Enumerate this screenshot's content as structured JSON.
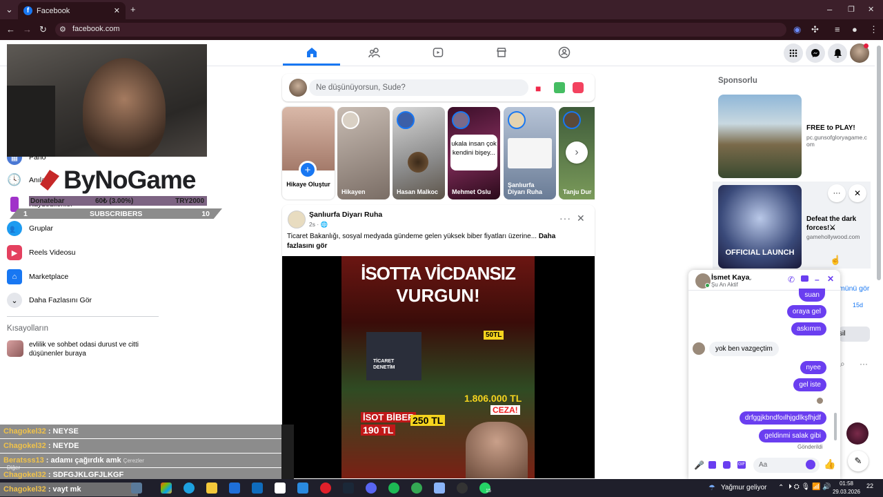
{
  "browser": {
    "tab_title": "Facebook",
    "new_tab": "+",
    "url": "facebook.com",
    "window_controls": [
      "–",
      "❐",
      "✕"
    ]
  },
  "facebook": {
    "nav_icons": [
      "home-icon",
      "friends-icon",
      "video-icon",
      "marketplace-icon",
      "groups-icon"
    ],
    "composer_placeholder": "Ne düşünüyorsun, Sude?",
    "left_items": [
      {
        "label": "Pano"
      },
      {
        "label": "Anılar"
      },
      {
        "label": "Kaydedilenler"
      },
      {
        "label": "Gruplar"
      },
      {
        "label": "Reels Videosu"
      },
      {
        "label": "Marketplace"
      },
      {
        "label": "Daha Fazlasını Gör"
      }
    ],
    "shortcuts_title": "Kısayolların",
    "shortcut_item": "evlilik ve sohbet odasi durust ve citti düşünenler buraya",
    "stories": [
      {
        "name": "Hikaye Oluştur"
      },
      {
        "name": "Hikayen"
      },
      {
        "name": "Hasan Malkoc"
      },
      {
        "name": "Mehmet Oslu"
      },
      {
        "name": "Şanlıurfa Diyarı Ruha"
      },
      {
        "name": "Tanju Durgu"
      }
    ],
    "story_bubble": "ukala insan çok kendini bişey...",
    "post": {
      "author": "Şanlıurfa Diyarı Ruha",
      "time": "2s · 🌐",
      "text": "Ticaret Bakanlığı, sosyal medyada gündeme gelen yüksek biber fiyatları üzerine...",
      "more": "Daha fazlasını gör",
      "poster_title_1": "İSOTTA VİCDANSIZ",
      "poster_title_2": "VURGUN!",
      "poster_label_1": "50TL",
      "poster_label_2": "1.806.000 TL",
      "poster_label_3": "CEZA!",
      "poster_label_4": "İSOT BİBER",
      "poster_label_5": "190 TL",
      "poster_label_6": "250 TL",
      "poster_label_7": "TİCARET DENETİM"
    },
    "sponsored_title": "Sponsorlu",
    "ads": [
      {
        "title": "FREE to PLAY!",
        "url": "pc.gunsofgloryagame.com"
      },
      {
        "title": "Defeat the dark forces!⚔",
        "url": "gamehollywood.com"
      }
    ],
    "ad_image_text": "OFFICIAL LAUNCH",
    "partial_texts": [
      "münü gör",
      "15d",
      "sil"
    ]
  },
  "chat": {
    "name": "İsmet Kaya",
    "status": "Şu An Aktif",
    "messages_out_1": [
      "suan",
      "oraya gel",
      "askımm"
    ],
    "message_in": "yok ben vazgeçtim",
    "messages_out_2": [
      "nyee",
      "gel iste"
    ],
    "messages_out_3": [
      "drfggjkbndfoılhjgdlkşfhjdf",
      "geldinmi salak gibi"
    ],
    "sent_status": "Gönderildi",
    "input_placeholder": "Aa"
  },
  "stream": {
    "brand": "ByNoGame",
    "donate_label": "Donatebar",
    "donate_value": "60₺ (3.00%)",
    "donate_goal": "TRY2000",
    "subs_start": "1",
    "subs_label": "SUBSCRIBERS",
    "subs_goal": "10",
    "chat_lines": [
      {
        "user": "Chagokel32",
        "text": ": NEYSE"
      },
      {
        "user": "Chagokel32",
        "text": ": NEYDE"
      },
      {
        "user": "Beratsss13",
        "text": ": adamı çağırdık amk"
      },
      {
        "user": "Chagokel32",
        "text": ": SDFGJKLGFJLKGF"
      },
      {
        "user": "Chagokel32",
        "text": ": vayt mk"
      }
    ],
    "extra_1": "Çerezler",
    "extra_2": "Diğer"
  },
  "taskbar": {
    "weather": "Yağmur geliyor",
    "time": "01:58",
    "date": "29.03.2026",
    "notification": "22",
    "whatsapp_badge": "15"
  }
}
